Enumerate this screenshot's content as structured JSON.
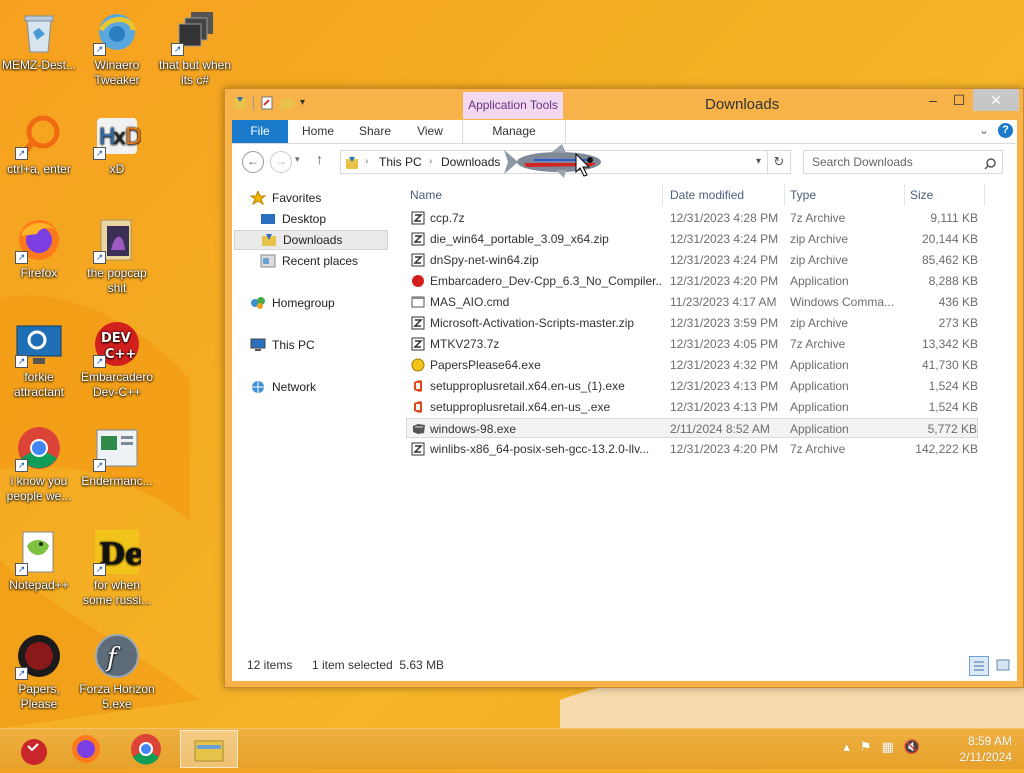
{
  "desktop": {
    "icons": [
      {
        "label": "MEMZ-Dest..."
      },
      {
        "label": "Winaero Tweaker"
      },
      {
        "label": "that but when its c#"
      },
      {
        "label": "ctrl+a, enter"
      },
      {
        "label": "xD"
      },
      {
        "label": "Firefox"
      },
      {
        "label": "the popcap shit"
      },
      {
        "label": "forkie attractant"
      },
      {
        "label": "Embarcadero Dev-C++"
      },
      {
        "label": "i know you people we..."
      },
      {
        "label": "Endermanc..."
      },
      {
        "label": "Notepad++"
      },
      {
        "label": "for when some russi..."
      },
      {
        "label": "Papers, Please"
      },
      {
        "label": "Forza Horizon 5.exe"
      }
    ]
  },
  "window": {
    "title": "Downloads",
    "context_tab": "Application Tools",
    "controls": {
      "minimize": "–",
      "maximize": "☐",
      "close": "✕"
    },
    "ribbon": {
      "tabs": [
        "File",
        "Home",
        "Share",
        "View",
        "Manage"
      ]
    },
    "address": {
      "crumbs": [
        "This PC",
        "Downloads"
      ],
      "search_placeholder": "Search Downloads"
    },
    "nav": {
      "favorites": "Favorites",
      "desktop": "Desktop",
      "downloads": "Downloads",
      "recent": "Recent places",
      "homegroup": "Homegroup",
      "thispc": "This PC",
      "network": "Network"
    },
    "columns": [
      "Name",
      "Date modified",
      "Type",
      "Size"
    ],
    "files": [
      {
        "name": "ccp.7z",
        "date": "12/31/2023 4:28 PM",
        "type": "7z Archive",
        "size": "9,111 KB"
      },
      {
        "name": "die_win64_portable_3.09_x64.zip",
        "date": "12/31/2023 4:24 PM",
        "type": "zip Archive",
        "size": "20,144 KB"
      },
      {
        "name": "dnSpy-net-win64.zip",
        "date": "12/31/2023 4:24 PM",
        "type": "zip Archive",
        "size": "85,462 KB"
      },
      {
        "name": "Embarcadero_Dev-Cpp_6.3_No_Compiler...",
        "date": "12/31/2023 4:20 PM",
        "type": "Application",
        "size": "8,288 KB"
      },
      {
        "name": "MAS_AIO.cmd",
        "date": "11/23/2023 4:17 AM",
        "type": "Windows Comma...",
        "size": "436 KB"
      },
      {
        "name": "Microsoft-Activation-Scripts-master.zip",
        "date": "12/31/2023 3:59 PM",
        "type": "zip Archive",
        "size": "273 KB"
      },
      {
        "name": "MTKV273.7z",
        "date": "12/31/2023 4:05 PM",
        "type": "7z Archive",
        "size": "13,342 KB"
      },
      {
        "name": "PapersPlease64.exe",
        "date": "12/31/2023 4:32 PM",
        "type": "Application",
        "size": "41,730 KB"
      },
      {
        "name": "setupproplusretail.x64.en-us_(1).exe",
        "date": "12/31/2023 4:13 PM",
        "type": "Application",
        "size": "1,524 KB"
      },
      {
        "name": "setupproplusretail.x64.en-us_.exe",
        "date": "12/31/2023 4:13 PM",
        "type": "Application",
        "size": "1,524 KB"
      },
      {
        "name": "windows-98.exe",
        "date": "2/11/2024 8:52 AM",
        "type": "Application",
        "size": "5,772 KB"
      },
      {
        "name": "winlibs-x86_64-posix-seh-gcc-13.2.0-llv...",
        "date": "12/31/2023 4:20 PM",
        "type": "7z Archive",
        "size": "142,222 KB"
      }
    ],
    "status": {
      "count": "12 items",
      "selection": "1 item selected  5.63 MB"
    }
  },
  "taskbar": {
    "time": "8:59 AM",
    "date": "2/11/2024"
  },
  "colors": {
    "accent": "#1979ca",
    "desktop": "#f7b52a",
    "selection": "#f3f3f3"
  }
}
